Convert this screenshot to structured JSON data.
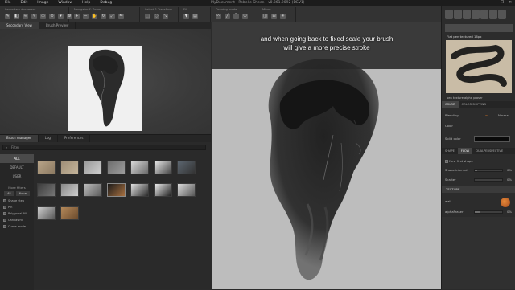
{
  "menubar": {
    "items": [
      "File",
      "Edit",
      "Image",
      "Window",
      "Help",
      "Debug"
    ],
    "title": "MyDocument - Rebelle Sheen - v0.361.2092 (DEV1)",
    "controls": [
      "—",
      "❐",
      "✕"
    ]
  },
  "toolbar": {
    "groups": [
      {
        "label": "Secondary document"
      },
      {
        "label": "Navigator & Zoom"
      },
      {
        "label": "Select & Transform"
      },
      {
        "label": "Fill"
      },
      {
        "label": "Drawing mode"
      },
      {
        "label": "Mirror"
      }
    ]
  },
  "left": {
    "tabs": [
      "Secondary View",
      "Brush Preview"
    ],
    "bm_tabs": [
      "Brush manager",
      "Log",
      "Preferences"
    ],
    "search_placeholder": "Filter",
    "categories": [
      "ALL",
      "DEFAULT",
      "USER"
    ],
    "more_filters": "More filters",
    "filter_buttons": [
      "All",
      "None"
    ],
    "filters": [
      "Shape step",
      "Pin",
      "Polygonal fill",
      "Canvas fill",
      "Curve mode"
    ]
  },
  "canvas": {
    "subtitle_line1": "and when going back to fixed scale your brush",
    "subtitle_line2": "will give a more precise stroke"
  },
  "right": {
    "brush_name": "Flat pen textured 16px",
    "texture_name": "pen texture alpha praser",
    "tabs1": [
      "COLOR",
      "COLOR SHIFTING"
    ],
    "blending_label": "Blending",
    "blending_value": "Normal",
    "color_label": "Color",
    "solid_color_label": "Solid color",
    "tabs2": [
      "SHAPE",
      "FLOW",
      "DUALPERSPECTIVE"
    ],
    "new_first_shape": "New first shape",
    "shape_interval_label": "Shape interval",
    "scatter_label": "Scatter",
    "pct": "0%",
    "texture_head": "TEXTURE",
    "texture_label": "wall",
    "alpha_label": "alphaPraser"
  },
  "colors": {
    "accent": "#e07a2a",
    "canvas_bg": "#bdbdbd"
  }
}
